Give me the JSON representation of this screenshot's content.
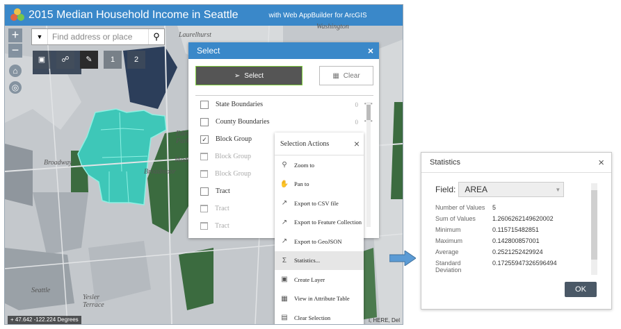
{
  "app": {
    "title": "2015 Median Household Income in Seattle",
    "subtitle": "with Web AppBuilder for ArcGIS"
  },
  "map": {
    "search_placeholder": "Find address or place",
    "zoom_in": "+",
    "zoom_out": "−",
    "coordinates": "47.642 -122.224 Degrees",
    "attribution": "i, HERE, Del",
    "labels": [
      "Laurelhurst",
      "Washington",
      "Broadway",
      "Broadmoor",
      "Seattle",
      "Yesler Terrace",
      "Madi",
      "Eden Park"
    ],
    "toolbar_numbers": [
      "1",
      "2"
    ],
    "colors": {
      "highlight": "#3ec7b8",
      "dark_green": "#3b6b3f",
      "navy": "#2c3e5a"
    }
  },
  "select_panel": {
    "title": "Select",
    "close": "×",
    "select_label": "Select",
    "clear_label": "Clear",
    "layers": [
      {
        "name": "State Boundaries",
        "count": "0",
        "more": "•••",
        "checked": false,
        "dim": false
      },
      {
        "name": "County Boundaries",
        "count": "0",
        "more": "•••",
        "checked": false,
        "dim": false
      },
      {
        "name": "Block Group",
        "count": "",
        "more": "",
        "checked": true,
        "dim": false
      },
      {
        "name": "Block Group",
        "count": "",
        "more": "",
        "checked": false,
        "dim": true
      },
      {
        "name": "Block Group",
        "count": "",
        "more": "",
        "checked": false,
        "dim": true
      },
      {
        "name": "Tract",
        "count": "",
        "more": "",
        "checked": false,
        "dim": false
      },
      {
        "name": "Tract",
        "count": "",
        "more": "",
        "checked": false,
        "dim": true
      },
      {
        "name": "Tract",
        "count": "",
        "more": "",
        "checked": false,
        "dim": true
      }
    ]
  },
  "selection_actions": {
    "title": "Selection Actions",
    "close": "×",
    "items": [
      {
        "label": "Zoom to",
        "icon": "zoom-to-icon"
      },
      {
        "label": "Pan to",
        "icon": "pan-to-icon"
      },
      {
        "label": "Export to CSV file",
        "icon": "export-icon"
      },
      {
        "label": "Export to Feature Collection",
        "icon": "export-icon"
      },
      {
        "label": "Export to GeoJSON",
        "icon": "export-icon"
      },
      {
        "label": "Statistics...",
        "icon": "sigma-icon"
      },
      {
        "label": "Create Layer",
        "icon": "create-layer-icon"
      },
      {
        "label": "View in Attribute Table",
        "icon": "table-icon"
      },
      {
        "label": "Clear Selection",
        "icon": "clear-selection-icon"
      }
    ],
    "highlighted": "Statistics..."
  },
  "statistics": {
    "title": "Statistics",
    "close": "×",
    "field_label": "Field:",
    "field_value": "AREA",
    "rows": [
      {
        "label": "Number of Values",
        "value": "5"
      },
      {
        "label": "Sum of Values",
        "value": "1.2606262149620002"
      },
      {
        "label": "Minimum",
        "value": "0.115715482851"
      },
      {
        "label": "Maximum",
        "value": "0.142800857001"
      },
      {
        "label": "Average",
        "value": "0.2521252429924"
      },
      {
        "label": "Standard Deviation",
        "value": "0.17255947326596494"
      }
    ],
    "ok_label": "OK"
  }
}
